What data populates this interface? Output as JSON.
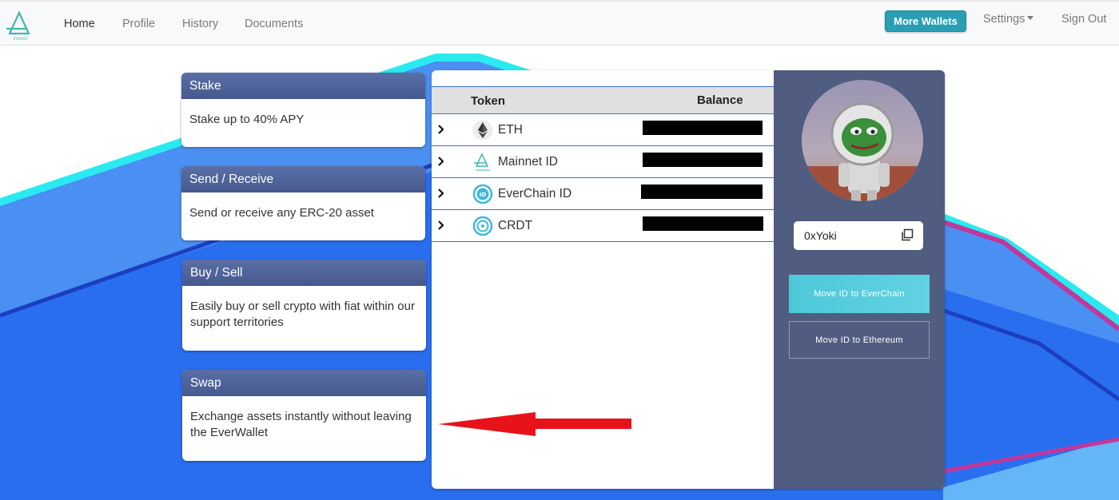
{
  "nav": {
    "links": [
      "Home",
      "Profile",
      "History",
      "Documents"
    ],
    "more_wallets": "More Wallets",
    "settings": "Settings",
    "sign_out": "Sign Out"
  },
  "cards": [
    {
      "title": "Stake",
      "body": "Stake up to 40% APY"
    },
    {
      "title": "Send / Receive",
      "body": "Send or receive any ERC-20 asset"
    },
    {
      "title": "Buy / Sell",
      "body": "Easily buy or sell crypto with fiat within our support territories"
    },
    {
      "title": "Swap",
      "body": "Exchange assets instantly without leaving the EverWallet"
    }
  ],
  "table": {
    "headers": {
      "token": "Token",
      "balance": "Balance"
    },
    "rows": [
      {
        "name": "ETH",
        "icon": "ethereum-icon",
        "balance_redacted": true
      },
      {
        "name": "Mainnet ID",
        "icon": "everest-logo-icon",
        "balance_redacted": true
      },
      {
        "name": "EverChain ID",
        "icon": "id-badge-icon",
        "balance_redacted": true
      },
      {
        "name": "CRDT",
        "icon": "crdt-coin-icon",
        "balance_redacted": true
      }
    ]
  },
  "profile": {
    "address": "0xYoki",
    "move_everchain": "Move ID to EverChain",
    "move_ethereum": "Move ID to Ethereum"
  },
  "colors": {
    "accent": "#2a9fb3",
    "card_header": "#4a5e93",
    "side_panel": "#505d80",
    "background_blue": "#2a6ef0",
    "arrow": "#e8121b"
  }
}
